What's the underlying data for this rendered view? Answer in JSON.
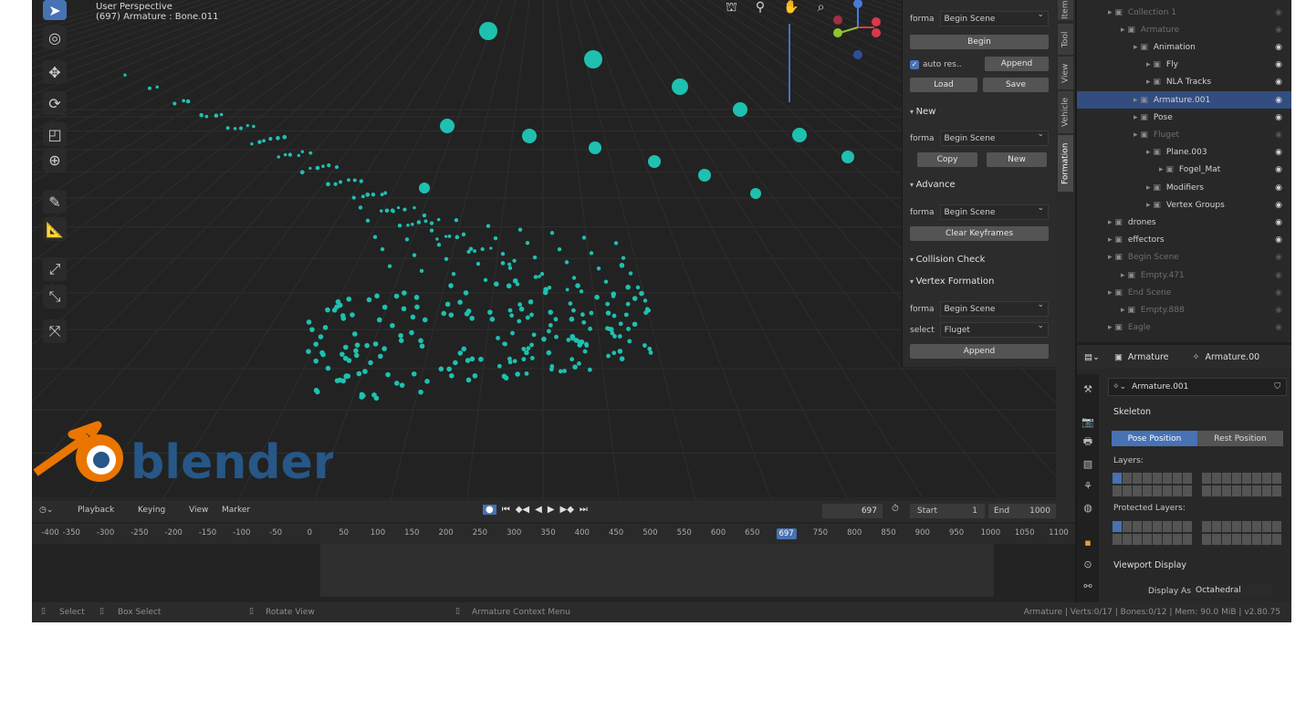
{
  "viewport": {
    "header_line1": "User Perspective",
    "header_line2": "(697) Armature : Bone.011"
  },
  "npanel": {
    "tabs": [
      "Item",
      "Tool",
      "View",
      "Vehicle",
      "Formation"
    ],
    "top_forma_label": "forma",
    "top_forma_value": "Begin Scene",
    "begin_button": "Begin",
    "auto_res_label": "auto res..",
    "append_button": "Append",
    "load_button": "Load",
    "save_button": "Save",
    "new_header": "New",
    "new_forma_label": "forma",
    "new_forma_value": "Begin Scene",
    "copy_button": "Copy",
    "new_button": "New",
    "advance_header": "Advance",
    "adv_forma_label": "forma",
    "adv_forma_value": "Begin Scene",
    "clear_keyframes_button": "Clear Keyframes",
    "collision_header": "Collision Check",
    "vertex_header": "Vertex Formation",
    "vf_forma_label": "forma",
    "vf_forma_value": "Begin Scene",
    "vf_select_label": "select",
    "vf_select_value": "Fluget",
    "vf_append_button": "Append"
  },
  "timeline": {
    "menus": [
      "Playback",
      "Keying",
      "View",
      "Marker"
    ],
    "current_frame": "697",
    "start_label": "Start",
    "start_value": "1",
    "end_label": "End",
    "end_value": "1000",
    "ticks": [
      "-400",
      "-350",
      "-300",
      "-250",
      "-200",
      "-150",
      "-100",
      "-50",
      "0",
      "50",
      "100",
      "150",
      "200",
      "250",
      "300",
      "350",
      "400",
      "450",
      "500",
      "550",
      "600",
      "650",
      "697",
      "750",
      "800",
      "850",
      "900",
      "950",
      "1000",
      "1050",
      "1100"
    ]
  },
  "statusbar": {
    "select": "Select",
    "box_select": "Box Select",
    "rotate_view": "Rotate View",
    "context_menu": "Armature Context Menu",
    "stats": "Armature | Verts:0/17 | Bones:0/12 | Mem: 90.0 MiB | v2.80.75"
  },
  "outliner": {
    "rows": [
      {
        "label": "Collection 1",
        "indent": 1,
        "dim": true
      },
      {
        "label": "Armature",
        "indent": 2,
        "dim": true
      },
      {
        "label": "Animation",
        "indent": 3,
        "dim": false
      },
      {
        "label": "Fly",
        "indent": 4,
        "dim": false
      },
      {
        "label": "NLA Tracks",
        "indent": 4,
        "dim": false
      },
      {
        "label": "Armature.001",
        "indent": 3,
        "dim": false,
        "selected": true
      },
      {
        "label": "Pose",
        "indent": 3,
        "dim": false
      },
      {
        "label": "Fluget",
        "indent": 3,
        "dim": true
      },
      {
        "label": "Plane.003",
        "indent": 4,
        "dim": false
      },
      {
        "label": "Fogel_Mat",
        "indent": 5,
        "dim": false
      },
      {
        "label": "Modifiers",
        "indent": 4,
        "dim": false
      },
      {
        "label": "Vertex Groups",
        "indent": 4,
        "dim": false
      },
      {
        "label": "drones",
        "indent": 1,
        "dim": false
      },
      {
        "label": "effectors",
        "indent": 1,
        "dim": false
      },
      {
        "label": "Begin Scene",
        "indent": 1,
        "dim": true
      },
      {
        "label": "Empty.471",
        "indent": 2,
        "dim": true
      },
      {
        "label": "End Scene",
        "indent": 1,
        "dim": true
      },
      {
        "label": "Empty.888",
        "indent": 2,
        "dim": true
      },
      {
        "label": "Eagle",
        "indent": 1,
        "dim": true
      }
    ]
  },
  "properties": {
    "header_object": "Armature",
    "header_data": "Armature.00",
    "data_name": "Armature.001",
    "skeleton_header": "Skeleton",
    "pose_position": "Pose Position",
    "rest_position": "Rest Position",
    "layers_label": "Layers:",
    "protected_layers_label": "Protected Layers:",
    "viewport_display_header": "Viewport Display",
    "display_as_label": "Display As",
    "display_as_value": "Octahedral"
  },
  "logo": {
    "text": "blender"
  },
  "colors": {
    "accent": "#4772b3",
    "particle": "#1fc0b0",
    "logo_orange": "#ea7600",
    "logo_blue": "#265787"
  }
}
